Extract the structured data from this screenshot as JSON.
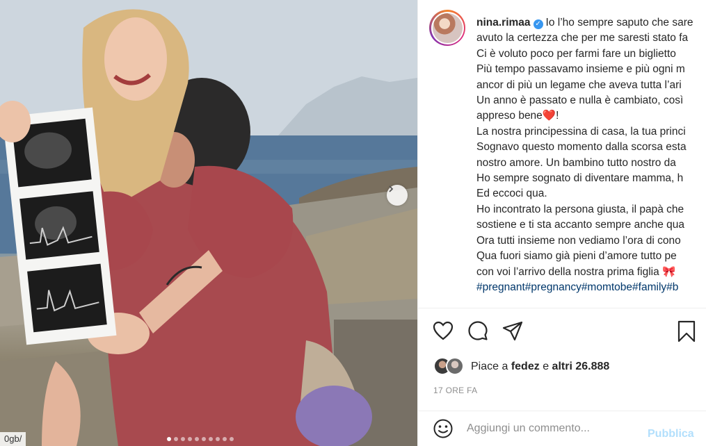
{
  "post": {
    "username": "nina.rimaa",
    "verified_icon": "verified-badge-icon",
    "caption_lines": [
      "Io l’ho sempre saputo che sare",
      "avuto la certezza che per me saresti stato fa",
      "Ci è voluto poco per farmi fare un biglietto",
      "Più tempo passavamo insieme e più ogni m",
      "ancor di più un legame che aveva tutta l’ari",
      "Un anno è passato e nulla è cambiato, così",
      "appreso bene",
      "La nostra principessina di casa, la tua princi",
      "Sognavo questo momento dalla scorsa esta",
      "nostro amore. Un bambino tutto nostro da",
      "Ho sempre sognato di diventare mamma, h",
      "Ed eccoci qua.",
      "Ho incontrato la persona giusta, il papà che",
      "sostiene e ti sta accanto sempre anche qua",
      "Ora tutti insieme non vediamo l’ora di cono",
      "Qua fuori siamo già pieni d’amore tutto pe",
      "con voi l’arrivo della nostra prima figlia"
    ],
    "line7_suffix": "!",
    "heart_emoji": "❤️",
    "bow_emoji": "🎀",
    "hashtags": "#pregnant#pregnancy#momtobe#family#b"
  },
  "likes": {
    "prefix": "Piace a ",
    "user": "fedez",
    "middle": " e ",
    "others": "altri 26.888"
  },
  "timestamp": "17 ORE FA",
  "comment": {
    "placeholder": "Aggiungi un commento...",
    "post_label": "Pubblica"
  },
  "photo": {
    "corner_tag": "0gb/",
    "carousel_total": 10,
    "carousel_active": 1
  },
  "icons": {
    "like": "heart-icon",
    "comment": "comment-icon",
    "share": "share-icon",
    "save": "bookmark-icon",
    "emoji": "emoji-icon",
    "next": "chevron-right-icon"
  }
}
